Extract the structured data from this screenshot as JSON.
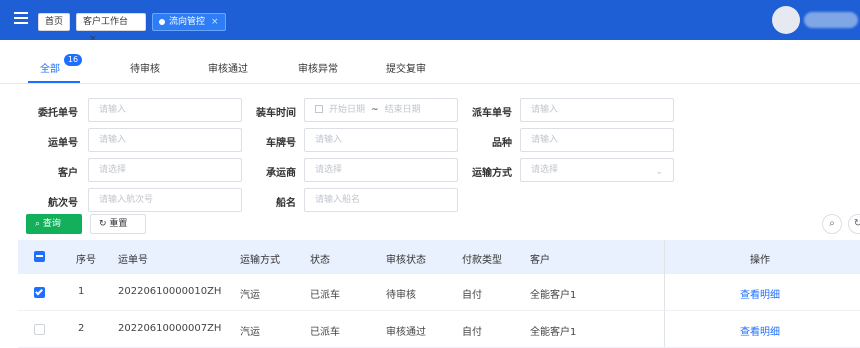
{
  "topbar": {
    "tabs": [
      {
        "label": "首页"
      },
      {
        "label": "客户工作台",
        "close": "×"
      },
      {
        "label": "流向管控",
        "close": "×"
      }
    ]
  },
  "status_tabs": [
    {
      "label": "全部",
      "badge": "16",
      "active": true
    },
    {
      "label": "待审核"
    },
    {
      "label": "审核通过"
    },
    {
      "label": "审核异常"
    },
    {
      "label": "提交复审"
    }
  ],
  "form": {
    "entrust_no": {
      "label": "委托单号",
      "placeholder": "请输入"
    },
    "load_time": {
      "label": "装车时间",
      "start": "开始日期",
      "sep": "~",
      "end": "结束日期"
    },
    "dispatch_no": {
      "label": "派车单号",
      "placeholder": "请输入"
    },
    "waybill_no": {
      "label": "运单号",
      "placeholder": "请输入"
    },
    "plate_no": {
      "label": "车牌号",
      "placeholder": "请输入"
    },
    "variety": {
      "label": "品种",
      "placeholder": "请输入"
    },
    "customer": {
      "label": "客户",
      "placeholder": "请选择"
    },
    "carrier": {
      "label": "承运商",
      "placeholder": "请选择"
    },
    "transport": {
      "label": "运输方式",
      "placeholder": "请选择"
    },
    "voyage_no": {
      "label": "航次号",
      "placeholder": "请输入航次号"
    },
    "ship_name": {
      "label": "船名",
      "placeholder": "请输入船名"
    }
  },
  "actions": {
    "query": "查询",
    "reset": "重置"
  },
  "table": {
    "headers": [
      "序号",
      "运单号",
      "运输方式",
      "状态",
      "审核状态",
      "付款类型",
      "客户",
      "操作"
    ],
    "rows": [
      {
        "index": "1",
        "waybill": "20220610000010ZH",
        "transport": "汽运",
        "status": "已派车",
        "audit": "待审核",
        "pay": "自付",
        "customer": "全能客户1",
        "op": "查看明细",
        "checked": true
      },
      {
        "index": "2",
        "waybill": "20220610000007ZH",
        "transport": "汽运",
        "status": "已派车",
        "audit": "审核通过",
        "pay": "自付",
        "customer": "全能客户1",
        "op": "查看明细",
        "checked": false
      }
    ]
  }
}
